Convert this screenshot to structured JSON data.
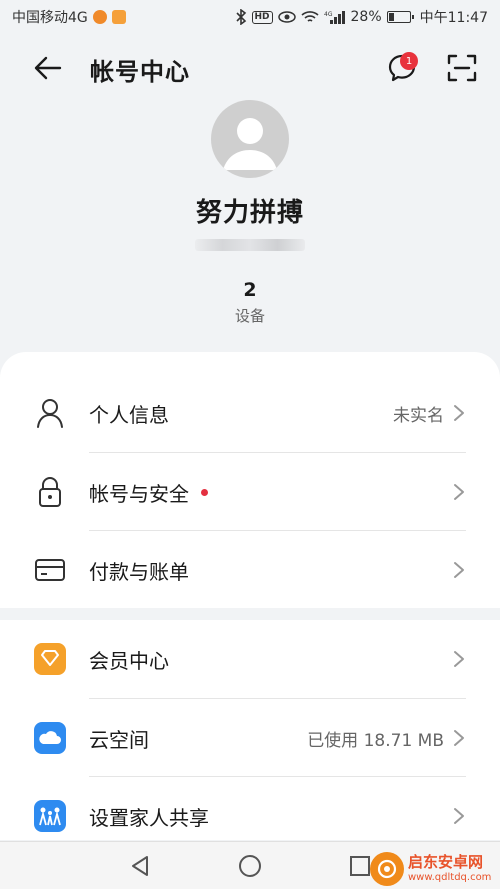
{
  "status_bar": {
    "carrier": "中国移动4G",
    "battery_percent": "28%",
    "time": "中午11:47",
    "network": "4G",
    "hd_label": "HD",
    "battery_level": 0.28
  },
  "header": {
    "title": "帐号中心",
    "message_badge": "1"
  },
  "profile": {
    "nickname": "努力拼搏",
    "device_count": "2",
    "device_label": "设备"
  },
  "menu_group_1": [
    {
      "label": "个人信息",
      "value": "未实名",
      "icon": "person-icon"
    },
    {
      "label": "帐号与安全",
      "value": "",
      "icon": "lock-icon",
      "has_dot": true
    },
    {
      "label": "付款与账单",
      "value": "",
      "icon": "card-icon"
    }
  ],
  "menu_group_2": [
    {
      "label": "会员中心",
      "value": "",
      "icon": "vip-diamond-icon"
    },
    {
      "label": "云空间",
      "value": "已使用 18.71 MB",
      "icon": "cloud-icon"
    },
    {
      "label": "设置家人共享",
      "value": "",
      "icon": "family-share-icon"
    }
  ],
  "watermark": {
    "name": "启东安卓网",
    "url": "www.qdltdq.com"
  },
  "colors": {
    "background": "#f1f3f5",
    "red_badge": "#e8323c",
    "vip_orange": "#f5a12a",
    "cloud_blue": "#2e8bf0"
  }
}
